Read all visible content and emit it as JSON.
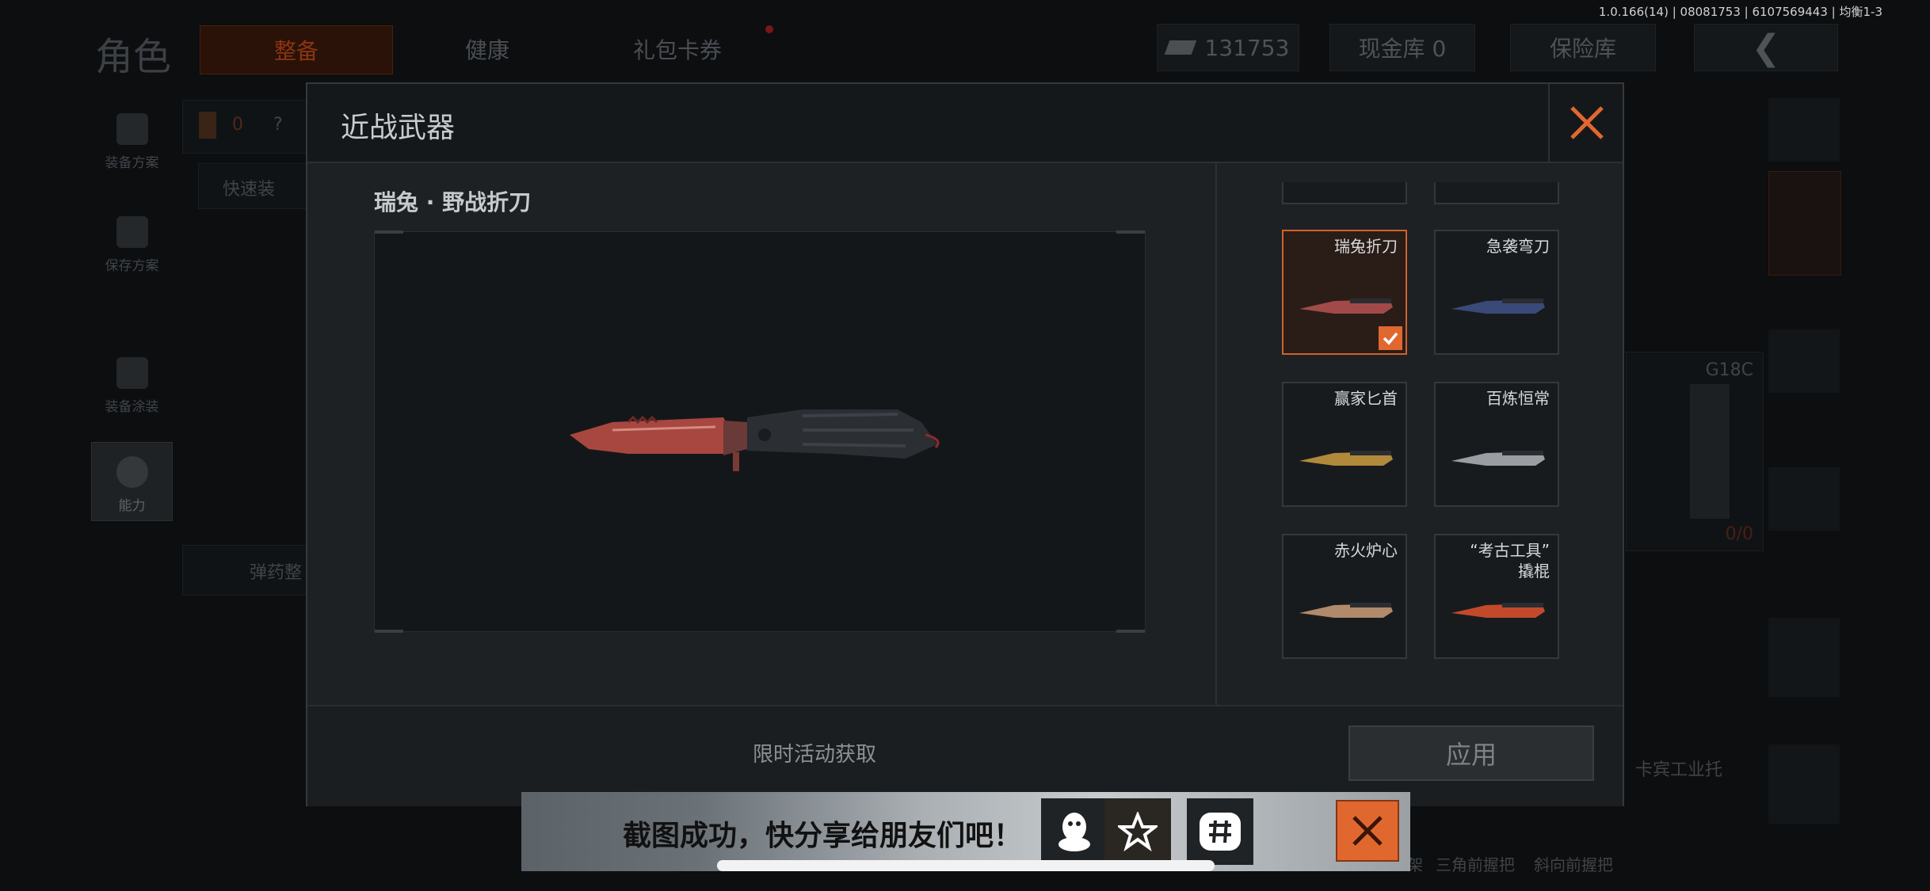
{
  "status_bar": {
    "version": "1.0.166(14) | 08081753 | 6107569443 | 均衡1-3"
  },
  "background": {
    "title": "角色",
    "tabs": [
      "整备",
      "健康",
      "礼包卡券"
    ],
    "currency": "131753",
    "cash_vault": "现金库 0",
    "insurance_vault": "保险库",
    "left_menu": [
      "装备方案",
      "保存方案",
      "装备涂装",
      "能力"
    ],
    "count_badge": "0",
    "quick_equip": "快速装",
    "ammo": "弹药整",
    "weapon_name": "G18C",
    "weapon_count": "0/0",
    "bottom_labels": [
      "卡宾工业托",
      "架",
      "三角前握把",
      "斜向前握把"
    ]
  },
  "modal": {
    "title": "近战武器",
    "item_name": "瑞兔 · 野战折刀",
    "source": "限时活动获取",
    "apply_label": "应用",
    "items": [
      {
        "label": "瑞兔折刀",
        "selected": true,
        "color": "#a24a4a"
      },
      {
        "label": "急袭弯刀",
        "selected": false,
        "color": "#3a4a78"
      },
      {
        "label": "赢家匕首",
        "selected": false,
        "color": "#b08a3a"
      },
      {
        "label": "百炼恒常",
        "selected": false,
        "color": "#9a9ea2"
      },
      {
        "label": "赤火炉心",
        "selected": false,
        "color": "#b08a6a"
      },
      {
        "label": "“考古工具”\n撬棍",
        "selected": false,
        "color": "#c24a2a"
      }
    ]
  },
  "share_banner": {
    "text": "截图成功，快分享给朋友们吧！",
    "icons": [
      "qq-icon",
      "qzone-icon",
      "wechat-icon"
    ]
  },
  "colors": {
    "accent": "#e0682f",
    "panel": "#1e2124"
  }
}
